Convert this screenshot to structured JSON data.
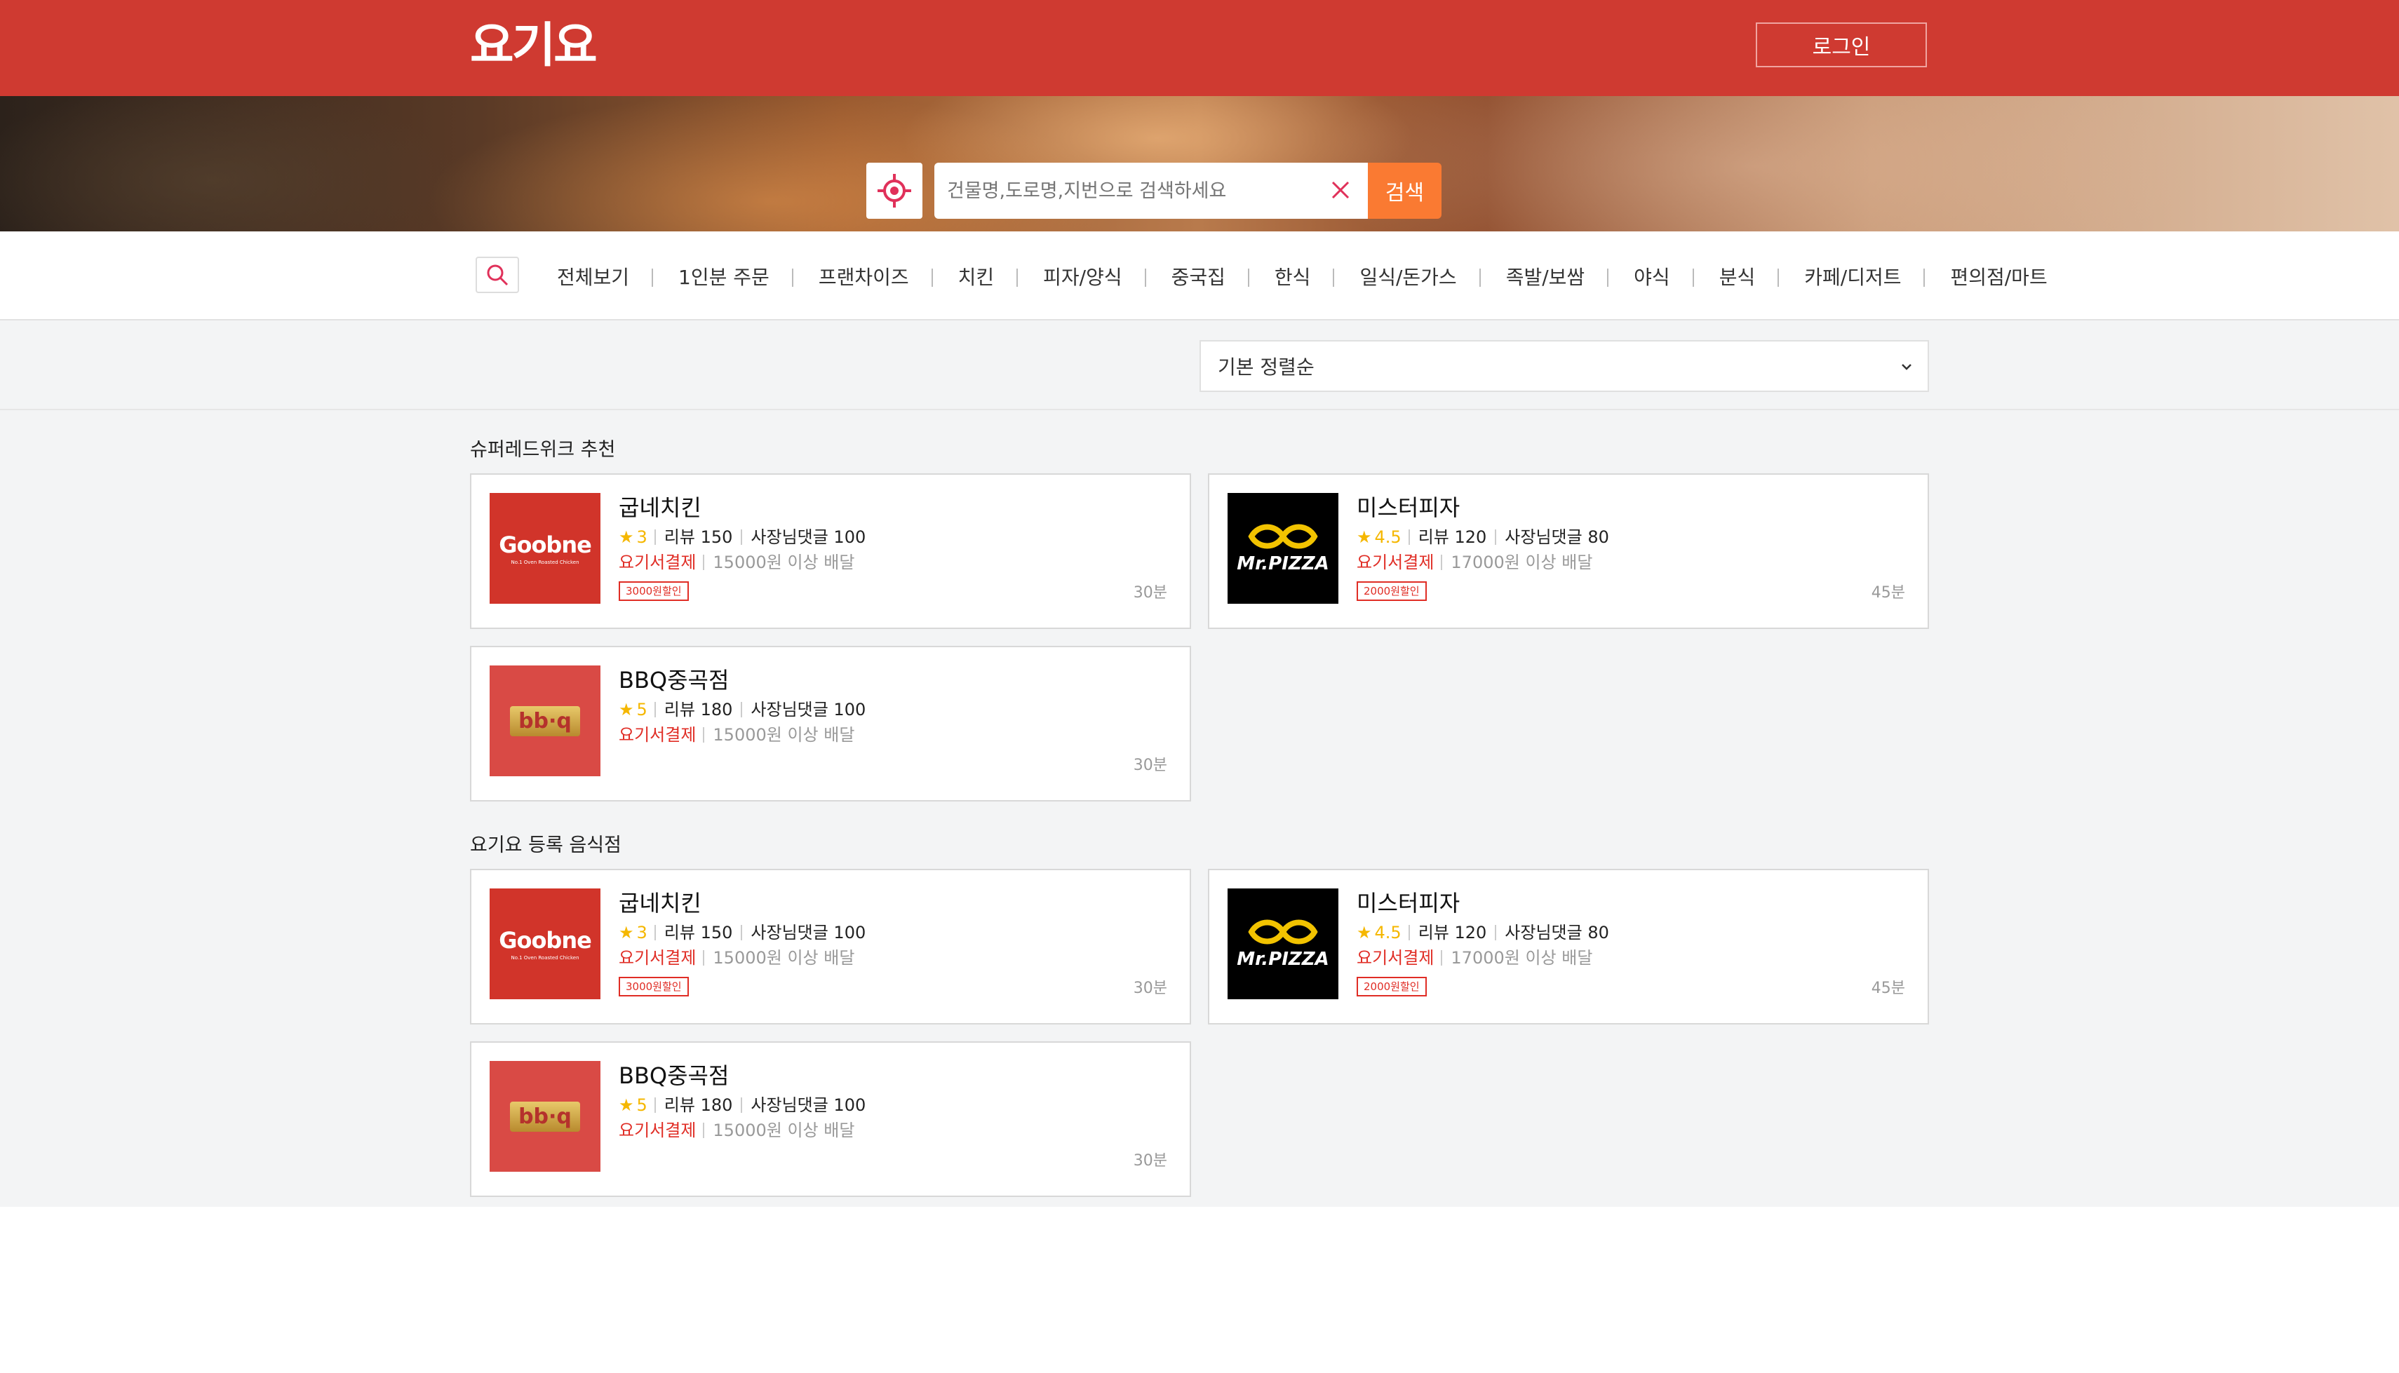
{
  "header": {
    "logo": "요기요",
    "login_label": "로그인"
  },
  "search": {
    "placeholder": "건물명,도로명,지번으로 검색하세요",
    "button_label": "검색"
  },
  "categories": [
    "전체보기",
    "1인분 주문",
    "프랜차이즈",
    "치킨",
    "피자/양식",
    "중국집",
    "한식",
    "일식/돈가스",
    "족발/보쌈",
    "야식",
    "분식",
    "카페/디저트",
    "편의점/마트"
  ],
  "sort": {
    "selected": "기본 정렬순"
  },
  "sections": [
    {
      "title": "슈퍼레드위크 추천",
      "restaurants": [
        {
          "name": "굽네치킨",
          "rating": "3",
          "reviews": "리뷰 150",
          "owner_replies": "사장님댓글 100",
          "payment": "요기서결제",
          "min_order": "15000원 이상 배달",
          "discount": "3000원할인",
          "time": "30분",
          "logo_text": "Goobne",
          "logo_sub": "No.1 Oven Roasted Chicken"
        },
        {
          "name": "미스터피자",
          "rating": "4.5",
          "reviews": "리뷰 120",
          "owner_replies": "사장님댓글 80",
          "payment": "요기서결제",
          "min_order": "17000원 이상 배달",
          "discount": "2000원할인",
          "time": "45분",
          "logo_text": "Mr.PIZZA"
        },
        {
          "name": "BBQ중곡점",
          "rating": "5",
          "reviews": "리뷰 180",
          "owner_replies": "사장님댓글 100",
          "payment": "요기서결제",
          "min_order": "15000원 이상 배달",
          "time": "30분",
          "logo_text": "bb·q"
        }
      ]
    },
    {
      "title": "요기요 등록 음식점",
      "restaurants": [
        {
          "name": "굽네치킨",
          "rating": "3",
          "reviews": "리뷰 150",
          "owner_replies": "사장님댓글 100",
          "payment": "요기서결제",
          "min_order": "15000원 이상 배달",
          "discount": "3000원할인",
          "time": "30분",
          "logo_text": "Goobne",
          "logo_sub": "No.1 Oven Roasted Chicken"
        },
        {
          "name": "미스터피자",
          "rating": "4.5",
          "reviews": "리뷰 120",
          "owner_replies": "사장님댓글 80",
          "payment": "요기서결제",
          "min_order": "17000원 이상 배달",
          "discount": "2000원할인",
          "time": "45분",
          "logo_text": "Mr.PIZZA"
        },
        {
          "name": "BBQ중곡점",
          "rating": "5",
          "reviews": "리뷰 180",
          "owner_replies": "사장님댓글 100",
          "payment": "요기서결제",
          "min_order": "15000원 이상 배달",
          "time": "30분",
          "logo_text": "bb·q"
        }
      ]
    }
  ],
  "icons": {
    "gps": "crosshair-icon",
    "clear": "close-icon",
    "search": "search-icon",
    "sort": "chevron-down-icon",
    "star": "star-icon"
  },
  "colors": {
    "brand": "#cf3a31",
    "search_button": "#fa7a32",
    "accent_red": "#e02d25",
    "star": "#f5b700"
  }
}
